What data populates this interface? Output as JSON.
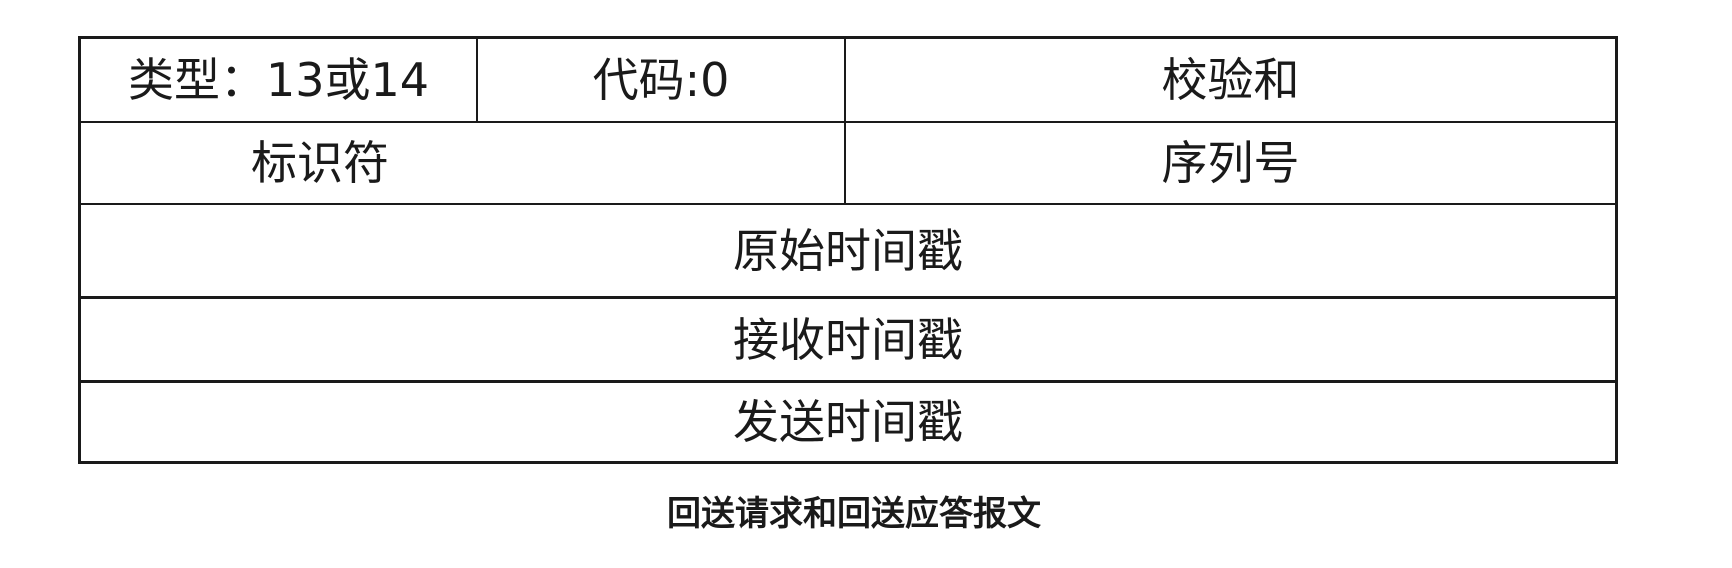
{
  "packet_format": {
    "row1": {
      "type": "类型：13或14",
      "code": "代码:0",
      "checksum": "校验和"
    },
    "row2": {
      "identifier": "标识符",
      "sequence_number": "序列号"
    },
    "row3": {
      "originate_timestamp": "原始时间戳"
    },
    "row4": {
      "receive_timestamp": "接收时间戳"
    },
    "row5": {
      "transmit_timestamp": "发送时间戳"
    }
  },
  "caption": "回送请求和回送应答报文"
}
